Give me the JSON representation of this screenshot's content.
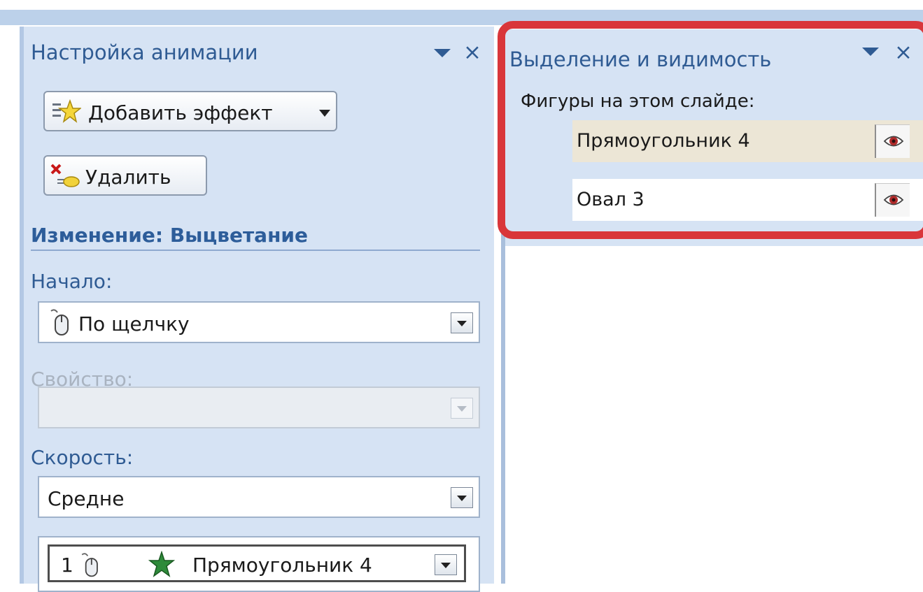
{
  "animation_pane": {
    "title": "Настройка анимации",
    "add_effect_label": "Добавить эффект",
    "remove_label": "Удалить",
    "section_title": "Изменение: Выцветание",
    "start_label": "Начало:",
    "start_value": "По щелчку",
    "property_label": "Свойство:",
    "property_value": "",
    "speed_label": "Скорость:",
    "speed_value": "Средне",
    "effect_list": [
      {
        "order": "1",
        "name": "Прямоугольник 4"
      }
    ]
  },
  "visibility_pane": {
    "title": "Выделение и видимость",
    "shapes_label": "Фигуры на этом слайде:",
    "shapes": [
      {
        "name": "Прямоугольник 4",
        "selected": true,
        "visible": true,
        "visibility_icon": "eye-icon"
      },
      {
        "name": "Овал 3",
        "selected": false,
        "visible": true,
        "visibility_icon": "eye-icon"
      }
    ]
  },
  "colors": {
    "pane_background": "#d6e3f4",
    "title_text": "#2f5b93",
    "highlight_frame": "#d9363a",
    "selected_row": "#ece6d6"
  },
  "icons": [
    "add-effect-icon",
    "delete-icon",
    "mouse-click-icon",
    "effect-star-icon",
    "eye-icon",
    "dropdown-arrow-icon",
    "close-icon"
  ]
}
